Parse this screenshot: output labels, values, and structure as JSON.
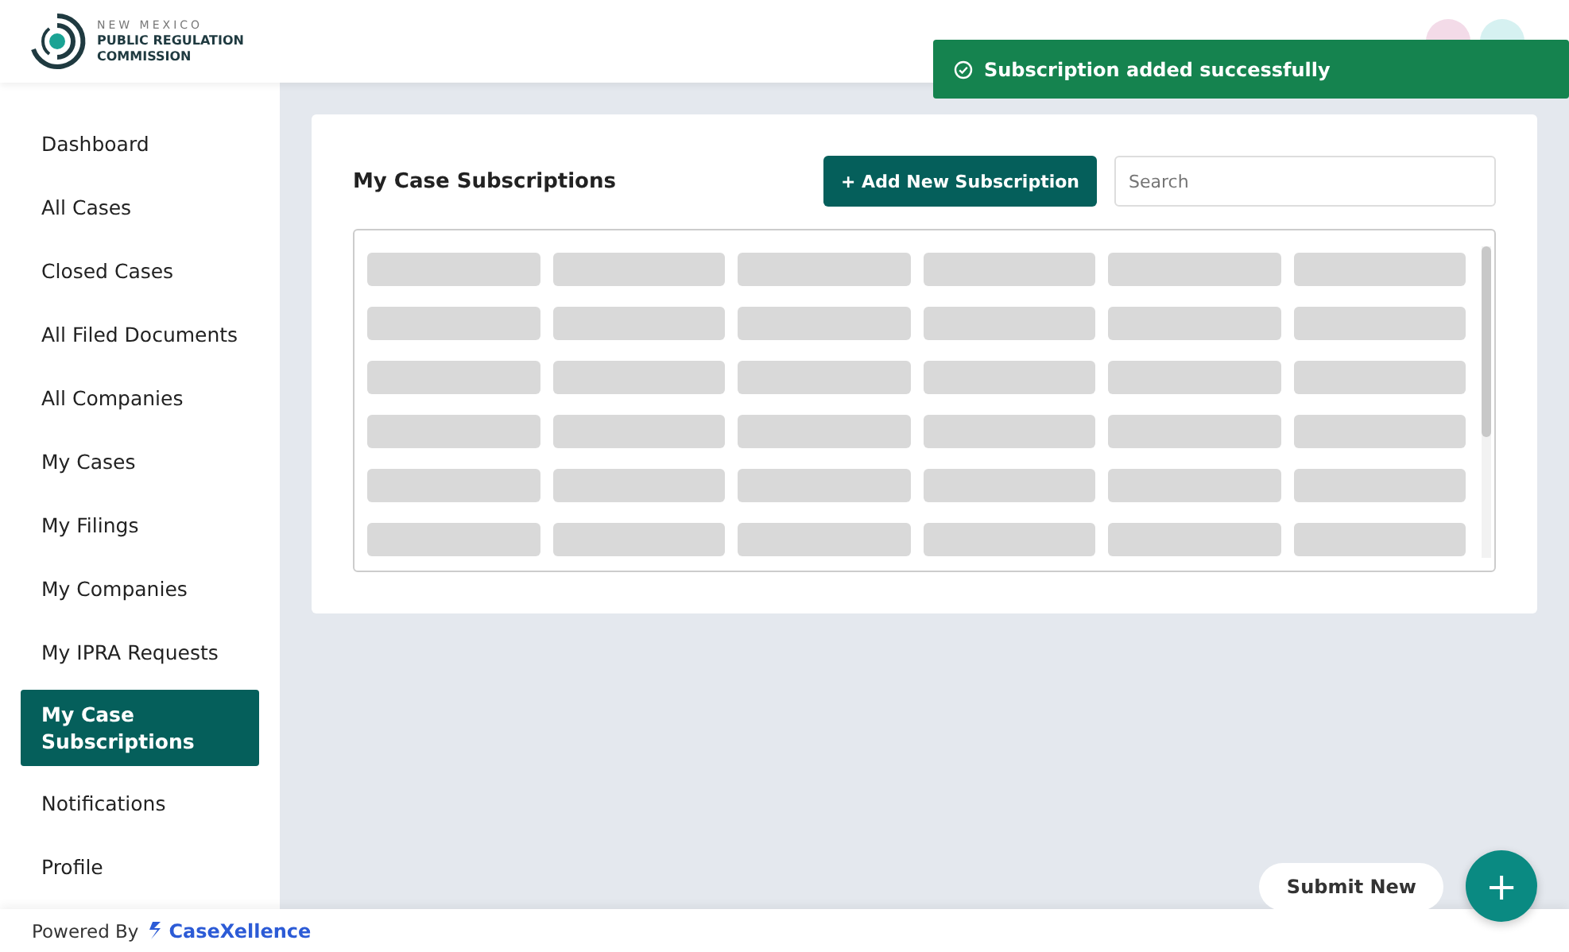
{
  "header": {
    "logo": {
      "line1": "NEW MEXICO",
      "line2": "PUBLIC REGULATION",
      "line3": "COMMISSION"
    }
  },
  "toast": {
    "kind": "success",
    "message": "Subscription added successfully"
  },
  "sidebar": {
    "items": [
      {
        "label": "Dashboard",
        "selected": false
      },
      {
        "label": "All Cases",
        "selected": false
      },
      {
        "label": "Closed Cases",
        "selected": false
      },
      {
        "label": "All Filed Documents",
        "selected": false
      },
      {
        "label": "All Companies",
        "selected": false
      },
      {
        "label": "My Cases",
        "selected": false
      },
      {
        "label": "My Filings",
        "selected": false
      },
      {
        "label": "My Companies",
        "selected": false
      },
      {
        "label": "My IPRA Requests",
        "selected": false
      },
      {
        "label": "My Case Subscriptions",
        "selected": true
      },
      {
        "label": "Notifications",
        "selected": false
      },
      {
        "label": "Profile",
        "selected": false
      }
    ]
  },
  "panel": {
    "title": "My Case Subscriptions",
    "add_button": "+ Add New Subscription",
    "search": {
      "placeholder": "Search"
    },
    "table": {
      "loading": true
    }
  },
  "fab": {
    "label": "Submit New",
    "icon": "+"
  },
  "footer": {
    "powered_by": "Powered By",
    "brand": "CaseXellence"
  }
}
